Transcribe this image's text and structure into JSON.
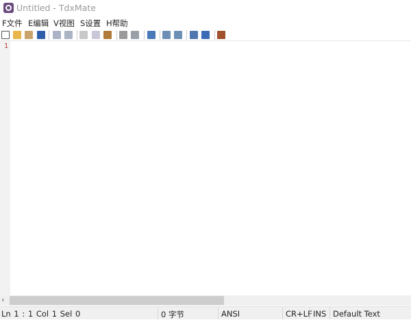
{
  "window": {
    "title": "Untitled - TdxMate"
  },
  "menu": [
    "F文件",
    "E编辑",
    "V视图",
    "S设置",
    "H帮助"
  ],
  "toolbar": {
    "buttons": [
      {
        "icon": "new-file-icon",
        "color": "#ffffff"
      },
      {
        "icon": "open-folder-icon",
        "color": "#e8b64a"
      },
      {
        "icon": "open-recent-icon",
        "color": "#c9a36b"
      },
      {
        "icon": "save-icon",
        "color": "#2f5fa8"
      },
      {
        "icon": "undo-icon",
        "color": "#aab4c4"
      },
      {
        "icon": "redo-icon",
        "color": "#aab4c4"
      },
      {
        "icon": "cut-icon",
        "color": "#c8c8c8"
      },
      {
        "icon": "copy-icon",
        "color": "#c8c8d8"
      },
      {
        "icon": "paste-icon",
        "color": "#b07a3a"
      },
      {
        "icon": "find-icon",
        "color": "#9a9a9a"
      },
      {
        "icon": "replace-icon",
        "color": "#9aa0a8"
      },
      {
        "icon": "goto-icon",
        "color": "#4a78b8"
      },
      {
        "icon": "zoom-in-icon",
        "color": "#6e8fb5"
      },
      {
        "icon": "zoom-out-icon",
        "color": "#6e8fb5"
      },
      {
        "icon": "options-icon",
        "color": "#5078b0"
      },
      {
        "icon": "chart-edit-icon",
        "color": "#3b6cb5"
      },
      {
        "icon": "exit-icon",
        "color": "#a0522d"
      }
    ]
  },
  "editor": {
    "line_numbers": [
      "1"
    ]
  },
  "status": {
    "position": "Ln 1 : 1   Col 1   Sel 0",
    "size": "0 字节",
    "encoding": "ANSI",
    "eol": "CR+LF",
    "mode": "INS",
    "scheme": "Default Text"
  },
  "scrollbar": {
    "left_arrow": "‹"
  }
}
